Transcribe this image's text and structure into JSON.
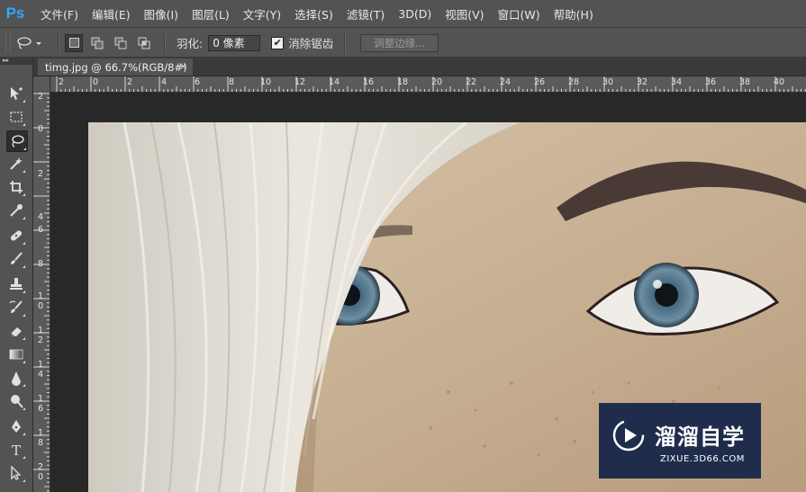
{
  "app": {
    "logo": "Ps"
  },
  "menu": [
    "文件(F)",
    "编辑(E)",
    "图像(I)",
    "图层(L)",
    "文字(Y)",
    "选择(S)",
    "滤镜(T)",
    "3D(D)",
    "视图(V)",
    "窗口(W)",
    "帮助(H)"
  ],
  "options": {
    "feather_label": "羽化:",
    "feather_value": "0 像素",
    "antialias_label": "消除锯齿",
    "antialias_checked": "✔",
    "refine_edge": "调整边缘..."
  },
  "toolbox": {
    "collapse": "▸▸"
  },
  "document": {
    "tab_title": "timg.jpg @ 66.7%(RGB/8#)",
    "close": "×"
  },
  "ruler_h": [
    "2",
    "0",
    "2",
    "4",
    "6",
    "8",
    "10",
    "12",
    "14",
    "16",
    "18",
    "20",
    "22",
    "24",
    "26",
    "28",
    "30",
    "32",
    "34",
    "36",
    "38",
    "40"
  ],
  "ruler_v": [
    "2",
    "0",
    "2",
    "4",
    "6",
    "8",
    "1 0",
    "1 2",
    "1 4",
    "1 6",
    "1 8",
    "2 0"
  ],
  "watermark": {
    "text": "溜溜自学",
    "url": "ZIXUE.3D66.COM"
  },
  "colors": {
    "accent": "#31a8ff",
    "background": "#535353",
    "canvas": "#282828"
  }
}
